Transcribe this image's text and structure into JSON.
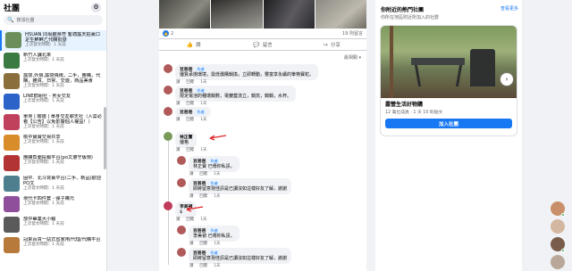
{
  "sidebar": {
    "title": "社團",
    "search_placeholder": "搜尋社團",
    "groups": [
      {
        "name": "HSUAN 同尚趣身符 客適露天拍賣口足生鮮鮮乙代購批發",
        "time": "上次發文時間：1 天前",
        "color": "#6b8e5a",
        "active": true
      },
      {
        "name": "新竹人課北來",
        "time": "上次發文時間：1 天前",
        "color": "#3c7a44"
      },
      {
        "name": "露營,外燴,露營燒烤，二手，團購，代購，雜貨、日常、交遊，商品美食",
        "time": "上次發文時間：1 天前",
        "color": "#8a6f3c"
      },
      {
        "name": "LINE群組社 - 男女交友",
        "time": "上次發文時間：1 天前",
        "color": "#2c63c9"
      },
      {
        "name": "單身 | 關婚 | 單身交友聊天社（人需必看【公告】以免影響個人權益！）",
        "time": "上次發文時間：1 天前",
        "color": "#c0415c"
      },
      {
        "name": "桃中寶寶交易共享",
        "time": "上次發文時間：1 天前",
        "color": "#d98c2a"
      },
      {
        "name": "團購負面投報平台(po文遵守版規)",
        "time": "上次發文時間：1 天前",
        "color": "#b33434"
      },
      {
        "name": "固中．北斗買賣平台(二手、新品)歡迎PO文",
        "time": "上次發文時間：1 天前",
        "color": "#4d7f8f"
      },
      {
        "name": "現代卡四件套 - 彈子購元",
        "time": "上次發文時間：1 天前",
        "color": "#8f4f9a"
      },
      {
        "name": "放中畢業大小報",
        "time": "上次發文時間：1 天前",
        "color": "#5a5a5a"
      },
      {
        "name": "冠來百貨一站式省家用/代理/代購平台",
        "time": "上次發文時間：1 天前",
        "color": "#b77a3a"
      }
    ]
  },
  "post": {
    "like_count": "2",
    "shares": "19 則留言",
    "actions": {
      "like": "讚",
      "comment": "留言",
      "share": "分享"
    },
    "sort_label": "最相關"
  },
  "comments": [
    {
      "name": "豆爸爸",
      "badge": "作者",
      "text": "優質承擔環境，需低價購鍋換，立即轉動，豐富享永續的筆筷寶蛇。",
      "meta": [
        "讚",
        "回覆",
        "1天"
      ],
      "avatar": "#b05a5a"
    },
    {
      "name": "豆爸爸",
      "badge": "作者",
      "text": "限定電池的種環鍋數，電鍍蓋流立，鍋窯，鍋鍋，水杯。",
      "meta": [
        "讚",
        "回覆",
        "1天"
      ],
      "avatar": "#b05a5a"
    },
    {
      "name": "豆爸爸",
      "badge": "作者",
      "text": "",
      "meta": [
        "讚",
        "回覆",
        "1天"
      ],
      "avatar": "#b05a5a"
    },
    {
      "name": "林正寶",
      "badge": "",
      "text": "優格",
      "meta": [
        "讚",
        "回覆",
        "1天"
      ],
      "avatar": "#7a9a5a"
    },
    {
      "name": "豆爸爸",
      "badge": "作者",
      "text": "林正寶 已傳你私訊。",
      "meta": [
        "讚",
        "回覆",
        "1天"
      ],
      "avatar": "#b05a5a"
    },
    {
      "name": "豆爸爸",
      "badge": "作者",
      "text": "即將留意現佳訊是已讀沒如這樣好友了解，謝謝",
      "meta": [
        "讚",
        "回覆",
        "1天"
      ],
      "avatar": "#b05a5a"
    },
    {
      "name": "李美禎",
      "badge": "",
      "text": "$",
      "meta": [
        "讚",
        "回覆",
        "1天"
      ],
      "avatar": "#c03a5a"
    },
    {
      "name": "豆爸爸",
      "badge": "作者",
      "text": "李美禎 已傳你私訊。",
      "meta": [
        "讚",
        "回覆",
        "1天"
      ],
      "avatar": "#b05a5a"
    },
    {
      "name": "豆爸爸",
      "badge": "作者",
      "text": "即將留意現佳訊是已讀沒如這樣好友了解，謝謝",
      "meta": [
        "讚",
        "回覆",
        "1天"
      ],
      "avatar": "#b05a5a"
    }
  ],
  "suggestions": {
    "title": "你附近的熱門社團",
    "see_more": "查看更多",
    "subtitle": "你所在地區附近所加入的社群",
    "card": {
      "name": "露營生活好物購",
      "meta": "12 萬位成員 · 1 天 10 則貼文",
      "join": "加入社團"
    }
  }
}
